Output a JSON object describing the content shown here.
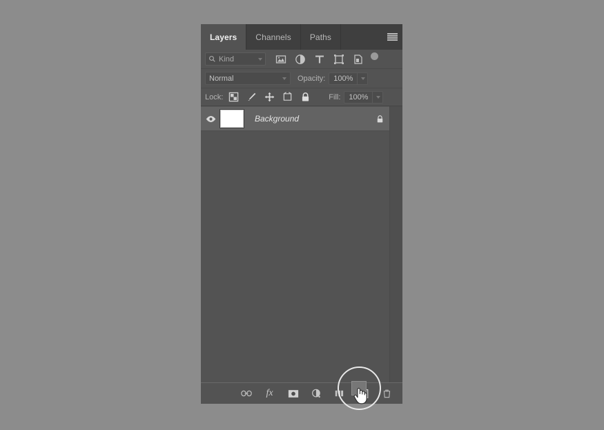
{
  "panel": {
    "tabs": [
      {
        "label": "Layers",
        "active": true
      },
      {
        "label": "Channels",
        "active": false
      },
      {
        "label": "Paths",
        "active": false
      }
    ],
    "menu_icon": "hamburger-menu-icon"
  },
  "filter_row": {
    "kind_label": "Kind",
    "search_icon": "search-icon",
    "dropdown_icon": "chevron-down-icon",
    "filter_icons": [
      "pixel-layer-filter-icon",
      "adjustment-layer-filter-icon",
      "type-layer-filter-icon",
      "shape-layer-filter-icon",
      "smart-object-filter-icon"
    ],
    "toggle_icon": "filter-toggle-switch"
  },
  "blend_row": {
    "blend_mode": "Normal",
    "opacity_label": "Opacity:",
    "opacity_value": "100%"
  },
  "lock_row": {
    "lock_label": "Lock:",
    "lock_icons": [
      "lock-transparent-pixels-icon",
      "lock-image-pixels-icon",
      "lock-position-icon",
      "lock-artboard-nesting-icon",
      "lock-all-icon"
    ],
    "fill_label": "Fill:",
    "fill_value": "100%"
  },
  "layers": [
    {
      "name": "Background",
      "visible": true,
      "locked": true,
      "visibility_icon": "eye-icon",
      "lock_icon": "lock-icon",
      "thumbnail": "white-thumbnail"
    }
  ],
  "bottom_bar": {
    "buttons": [
      {
        "name": "link-layers-button",
        "icon": "link-icon",
        "label": ""
      },
      {
        "name": "layer-style-button",
        "icon": "fx-icon",
        "label": "fx"
      },
      {
        "name": "add-layer-mask-button",
        "icon": "mask-icon",
        "label": ""
      },
      {
        "name": "adjustment-layer-button",
        "icon": "adjustment-circle-icon",
        "label": ""
      },
      {
        "name": "new-group-button",
        "icon": "folder-icon",
        "label": ""
      },
      {
        "name": "new-layer-button",
        "icon": "new-layer-icon",
        "label": ""
      },
      {
        "name": "delete-layer-button",
        "icon": "trash-icon",
        "label": ""
      }
    ],
    "highlighted_button": "new-layer-button",
    "cursor_icon": "hand-pointer-cursor"
  },
  "colors": {
    "page_background": "#8c8c8c",
    "panel_background": "#535353",
    "tabbar_background": "#3f3f3f",
    "layer_row_background": "#636363",
    "text_primary": "#e6e6e6",
    "text_secondary": "#b4b4b4",
    "highlight_ring": "#e9e9e9"
  }
}
